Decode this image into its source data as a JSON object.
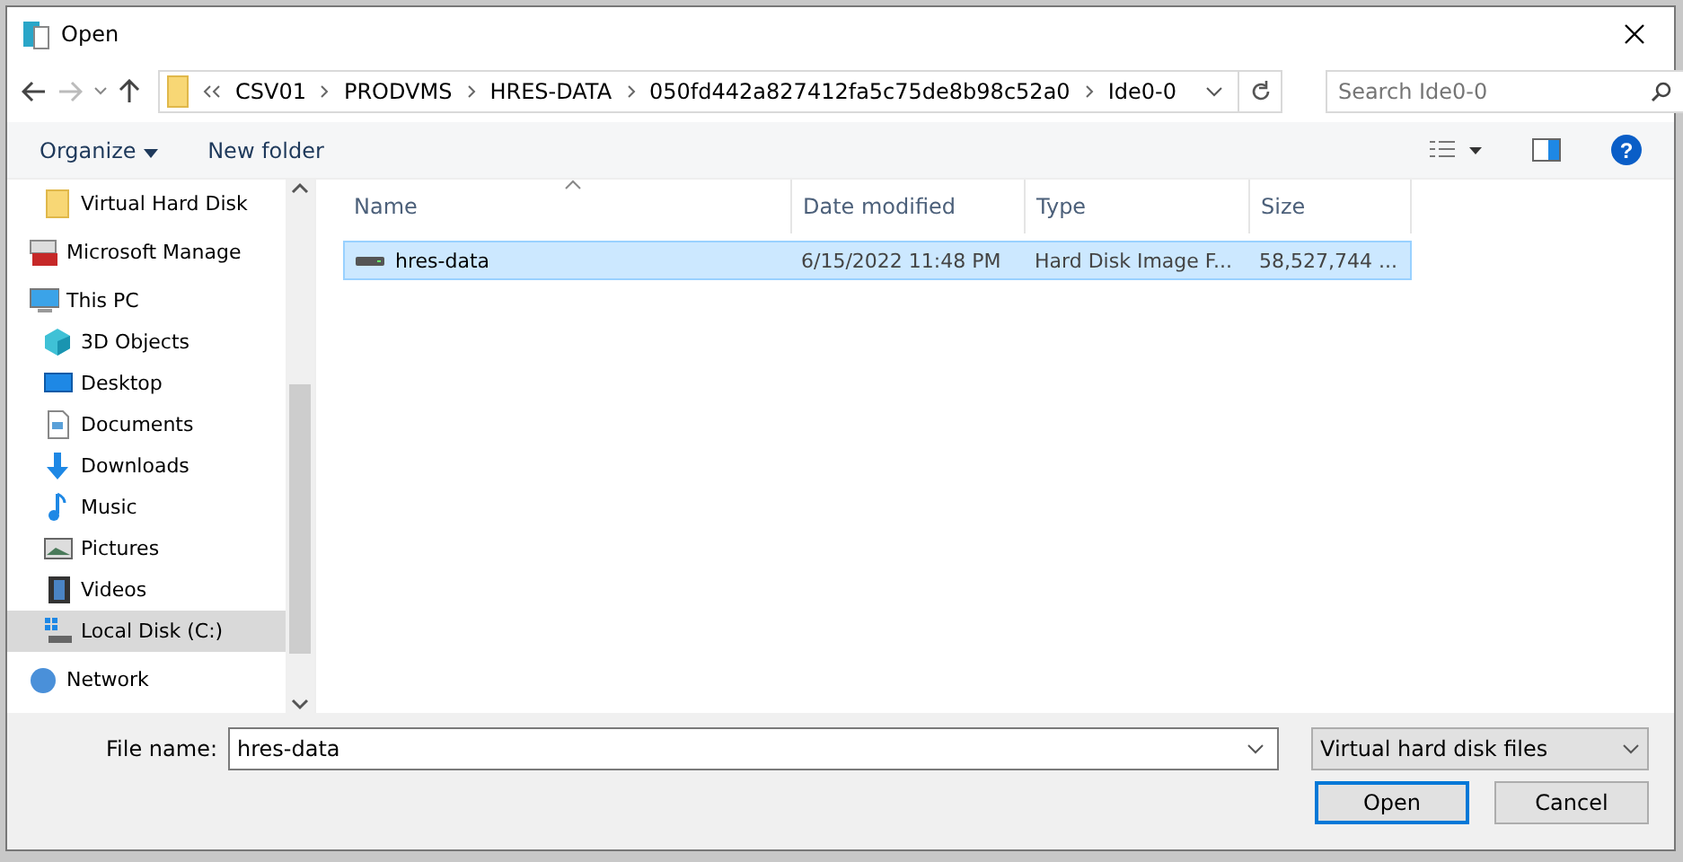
{
  "window": {
    "title": "Open"
  },
  "address": {
    "crumbs": [
      "CSV01",
      "PRODVMS",
      "HRES-DATA",
      "050fd442a827412fa5c75de8b98c52a0",
      "Ide0-0"
    ]
  },
  "search": {
    "placeholder": "Search Ide0-0"
  },
  "toolbar": {
    "organize": "Organize",
    "new_folder": "New folder",
    "help": "?"
  },
  "sidebar": {
    "items": [
      {
        "label": "Virtual Hard Disk",
        "kind": "folder",
        "selected": false
      },
      {
        "label": "Microsoft Manage",
        "kind": "toolbox",
        "selected": false
      },
      {
        "label": "This PC",
        "kind": "pc",
        "selected": false,
        "children": [
          {
            "label": "3D Objects",
            "kind": "cube",
            "selected": false
          },
          {
            "label": "Desktop",
            "kind": "desktop",
            "selected": false
          },
          {
            "label": "Documents",
            "kind": "document",
            "selected": false
          },
          {
            "label": "Downloads",
            "kind": "download",
            "selected": false
          },
          {
            "label": "Music",
            "kind": "music",
            "selected": false
          },
          {
            "label": "Pictures",
            "kind": "picture",
            "selected": false
          },
          {
            "label": "Videos",
            "kind": "video",
            "selected": false
          },
          {
            "label": "Local Disk (C:)",
            "kind": "disk",
            "selected": true
          }
        ]
      },
      {
        "label": "Network",
        "kind": "network",
        "selected": false
      }
    ]
  },
  "table": {
    "columns": [
      "Name",
      "Date modified",
      "Type",
      "Size"
    ],
    "rows": [
      {
        "cells": [
          "hres-data",
          "6/15/2022 11:48 PM",
          "Hard Disk Image F...",
          "58,527,744 ..."
        ],
        "selected": true
      }
    ]
  },
  "footer": {
    "file_name_label": "File name:",
    "file_name": "hres-data",
    "filter": "Virtual hard disk files",
    "buttons": [
      "Open",
      "Cancel"
    ]
  }
}
